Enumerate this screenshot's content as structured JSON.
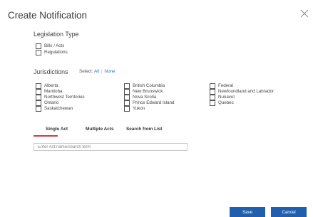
{
  "dialog": {
    "title": "Create Notification",
    "close_icon": "close-icon"
  },
  "legislation": {
    "heading": "Legislation Type",
    "options": [
      "Bills / Acts",
      "Regulations"
    ]
  },
  "jurisdictions": {
    "heading": "Jurisdictions",
    "select_label": "Select:",
    "select_all": "All",
    "select_none": "None",
    "columns": [
      [
        "Alberta",
        "Manitoba",
        "Northwest Territories",
        "Ontario",
        "Saskatchewan"
      ],
      [
        "British Columbia",
        "New Brunswick",
        "Nova Scotia",
        "Prince Edward Island",
        "Yukon"
      ],
      [
        "Federal",
        "Newfoundland and Labrador",
        "Nunavut",
        "Quebec"
      ]
    ]
  },
  "tabs": [
    "Single Act",
    "Multiple Acts",
    "Search from List"
  ],
  "search": {
    "placeholder": "Enter Act name/search term",
    "value": ""
  },
  "buttons": {
    "save": "Save",
    "cancel": "Cancel"
  },
  "colors": {
    "accent": "#1f5fae",
    "tab_underline": "#d23b3b",
    "link": "#2a76c8"
  }
}
